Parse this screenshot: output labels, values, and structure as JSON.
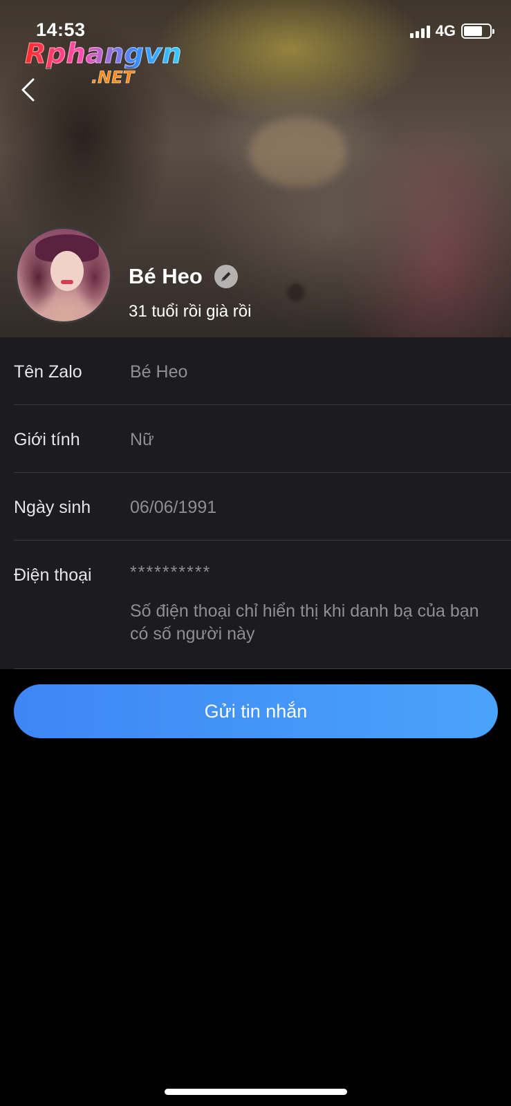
{
  "status_bar": {
    "time": "14:53",
    "network": "4G",
    "icons": [
      "signal-icon",
      "battery-icon"
    ]
  },
  "watermark": {
    "main": "Rphangvn",
    "sub": ".NET"
  },
  "header": {
    "back_icon": "chevron-left-icon",
    "name": "Bé Heo",
    "edit_icon": "pencil-icon",
    "status": "31 tuổi rồi già rồi"
  },
  "info": {
    "rows": [
      {
        "label": "Tên Zalo",
        "value": "Bé Heo"
      },
      {
        "label": "Giới tính",
        "value": "Nữ"
      },
      {
        "label": "Ngày sinh",
        "value": "06/06/1991"
      },
      {
        "label": "Điện thoại",
        "value": "**********",
        "note": "Số điện thoại chỉ hiển thị khi danh bạ của bạn có số người này"
      }
    ]
  },
  "actions": {
    "send_message": "Gửi tin nhắn"
  },
  "colors": {
    "accent": "#3e86f5",
    "panel": "#1c1c1e",
    "muted_text": "#8e8e93"
  }
}
